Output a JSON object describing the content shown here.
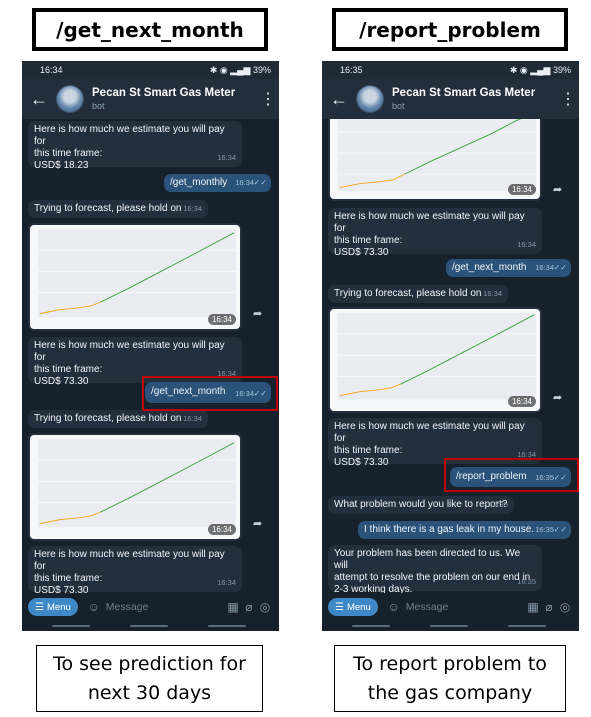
{
  "left": {
    "command_label": "/get_next_month",
    "caption": "To see prediction for\nnext 30 days",
    "status_time": "16:34",
    "status_right": "39%",
    "bot_title": "Pecan St Smart Gas Meter",
    "bot_subtitle": "bot",
    "messages": {
      "m1_text": "Here is how much we estimate you will pay for\nthis time frame:\nUSD$ 18.23",
      "m1_time": "16:34",
      "m2_text": "/get_monthly",
      "m2_time": "16:34",
      "m3_text": "Trying to forecast, please hold on",
      "m3_time": "16:34",
      "p1_time": "16:34",
      "m4_text": "Here is how much we estimate you will pay for\nthis time frame:\nUSD$ 73.30",
      "m4_time": "16:34",
      "m5_text": "/get_next_month",
      "m5_time": "16:34",
      "m6_text": "Trying to forecast, please hold on",
      "m6_time": "16:34",
      "p2_time": "16:34",
      "m7_text": "Here is how much we estimate you will pay for\nthis time frame:\nUSD$ 73.30",
      "m7_time": "16:34"
    },
    "menu_label": "Menu",
    "input_placeholder": "Message"
  },
  "right": {
    "command_label": "/report_problem",
    "caption": "To report problem to\nthe gas company",
    "status_time": "16:35",
    "status_right": "39%",
    "bot_title": "Pecan St Smart Gas Meter",
    "bot_subtitle": "bot",
    "messages": {
      "p1_time": "16:34",
      "m1_text": "Here is how much we estimate you will pay for\nthis time frame:\nUSD$ 73.30",
      "m1_time": "16:34",
      "m2_text": "/get_next_month",
      "m2_time": "16:34",
      "m3_text": "Trying to forecast, please hold on",
      "m3_time": "16:34",
      "p2_time": "16:34",
      "m4_text": "Here is how much we estimate you will pay for\nthis time frame:\nUSD$ 73.30",
      "m4_time": "16:34",
      "m5_text": "/report_problem",
      "m5_time": "16:35",
      "m6_text": "What problem would you like to report?",
      "m6_time": "16:35",
      "m7_text": "I think there is a gas leak in my house.",
      "m7_time": "16:35",
      "m8_text": "Your problem has been directed to us. We will\nattempt to resolve the problem on our end in\n2-3 working days.",
      "m8_time": "16:35"
    },
    "menu_label": "Menu",
    "input_placeholder": "Message"
  },
  "colors": {
    "chat_bg": "#17212b",
    "incoming_bubble": "#242f3d",
    "outgoing_bubble": "#2b5278",
    "highlight": "#c00000",
    "history_line": "#f5a623",
    "forecast_line": "#3aa53a"
  },
  "icons": [
    "back-arrow-icon",
    "more-vert-icon",
    "share-icon",
    "sticker-icon",
    "grid-icon",
    "attach-icon",
    "camera-icon",
    "double-check-icon"
  ]
}
